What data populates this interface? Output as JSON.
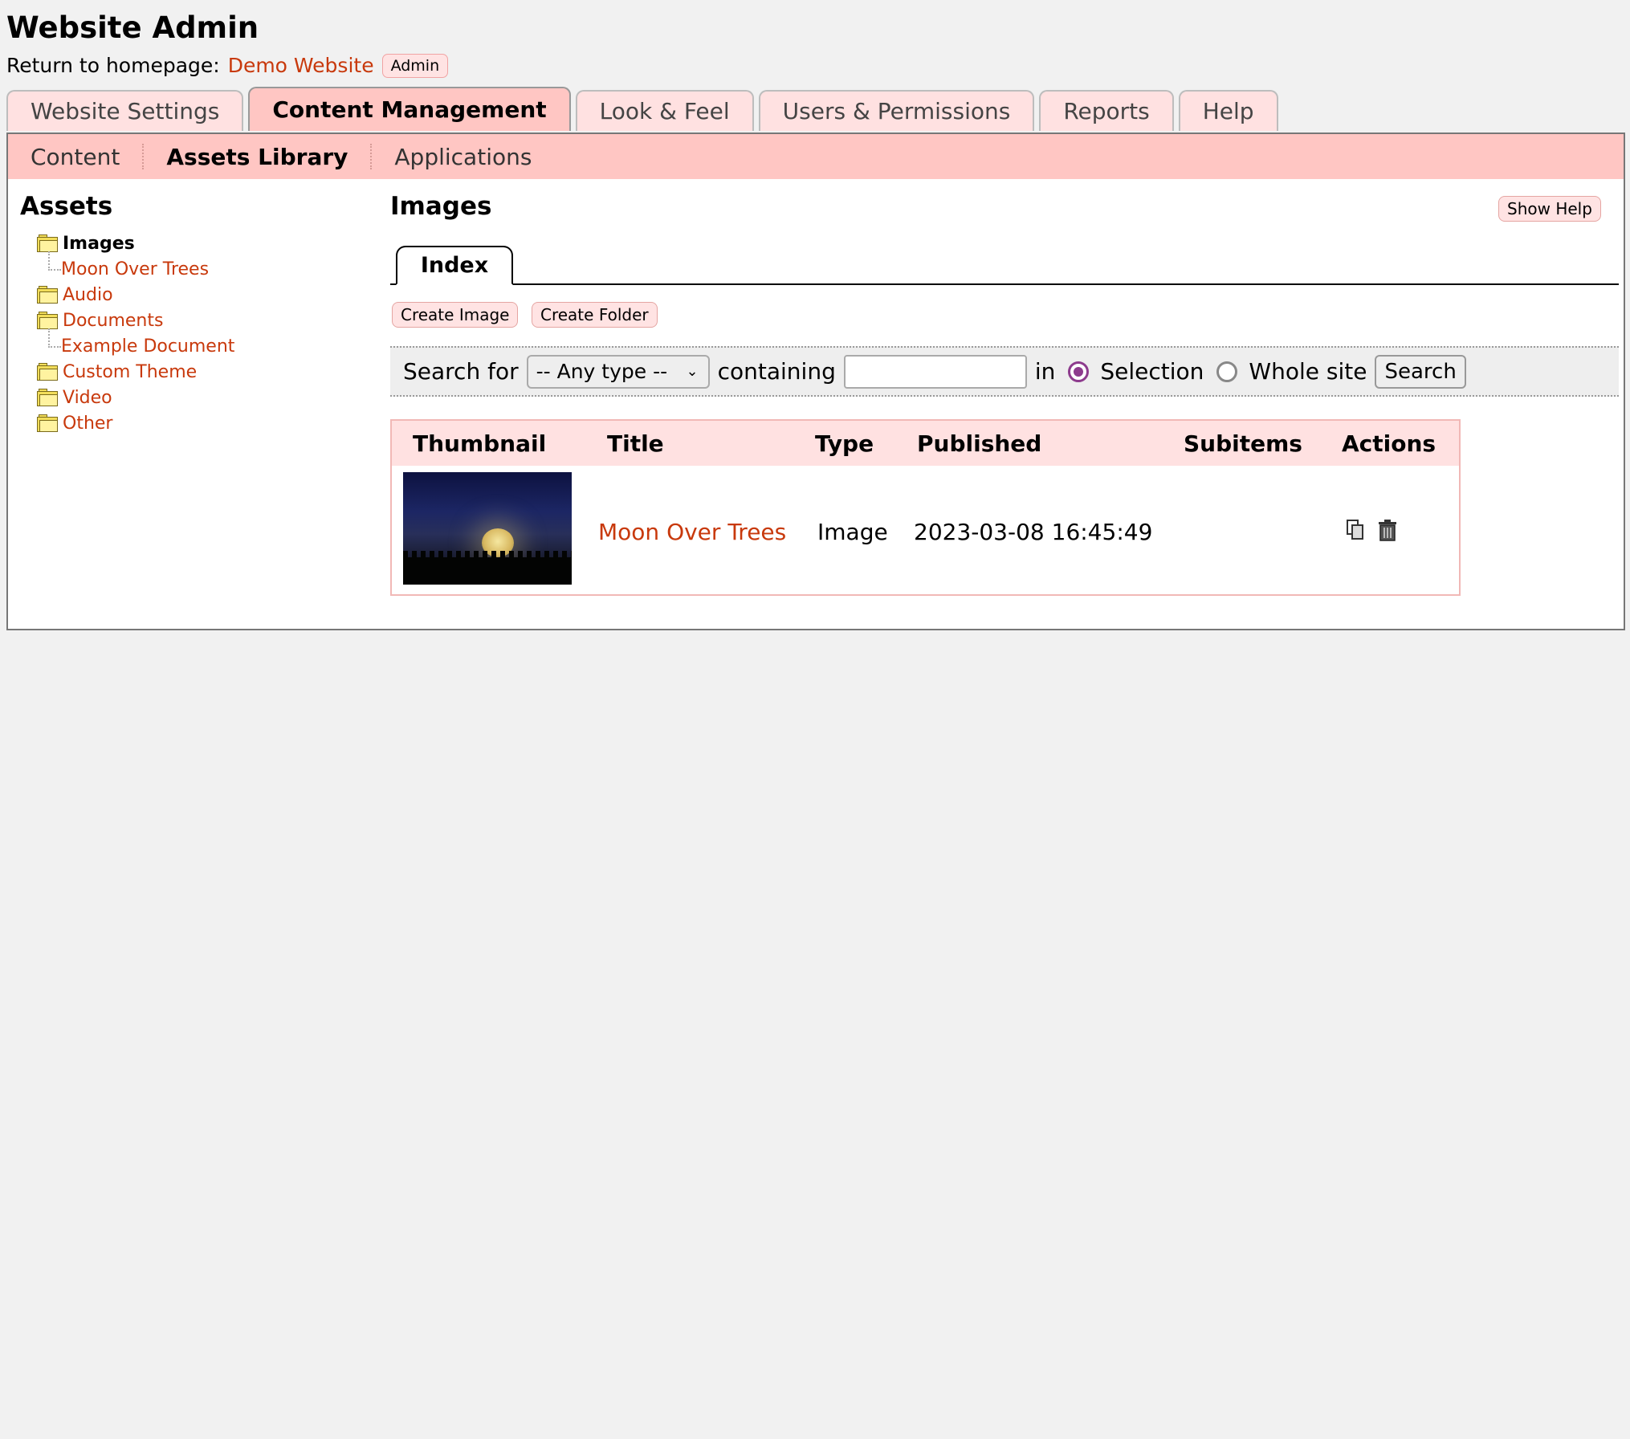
{
  "header": {
    "title": "Website Admin",
    "return_label": "Return to homepage:",
    "home_link": "Demo Website",
    "admin_badge": "Admin"
  },
  "top_tabs": [
    {
      "label": "Website Settings",
      "active": false
    },
    {
      "label": "Content Management",
      "active": true
    },
    {
      "label": "Look & Feel",
      "active": false
    },
    {
      "label": "Users & Permissions",
      "active": false
    },
    {
      "label": "Reports",
      "active": false
    },
    {
      "label": "Help",
      "active": false
    }
  ],
  "sub_nav": [
    {
      "label": "Content",
      "active": false
    },
    {
      "label": "Assets Library",
      "active": true
    },
    {
      "label": "Applications",
      "active": false
    }
  ],
  "sidebar": {
    "title": "Assets",
    "tree": [
      {
        "label": "Images",
        "type": "folder",
        "current": true
      },
      {
        "label": "Moon Over Trees",
        "type": "child"
      },
      {
        "label": "Audio",
        "type": "folder"
      },
      {
        "label": "Documents",
        "type": "folder"
      },
      {
        "label": "Example Document",
        "type": "child"
      },
      {
        "label": "Custom Theme",
        "type": "folder"
      },
      {
        "label": "Video",
        "type": "folder"
      },
      {
        "label": "Other",
        "type": "folder"
      }
    ]
  },
  "content": {
    "title": "Images",
    "show_help": "Show Help",
    "index_tab": "Index",
    "create_image": "Create Image",
    "create_folder": "Create Folder"
  },
  "search": {
    "search_for": "Search for",
    "type_value": "-- Any type --",
    "containing": "containing",
    "query_value": "",
    "in_label": "in",
    "option_selection": "Selection",
    "option_whole_site": "Whole site",
    "selected_option": "Selection",
    "button": "Search"
  },
  "table": {
    "columns": [
      "Thumbnail",
      "Title",
      "Type",
      "Published",
      "Subitems",
      "Actions"
    ],
    "rows": [
      {
        "title": "Moon Over Trees",
        "type": "Image",
        "published": "2023-03-08 16:45:49",
        "subitems": ""
      }
    ]
  },
  "colors": {
    "link": "#c8390c",
    "tab_active": "#ffc6c3",
    "tab_inactive": "#ffe1e1",
    "radio_checked": "#8d3b8d"
  }
}
